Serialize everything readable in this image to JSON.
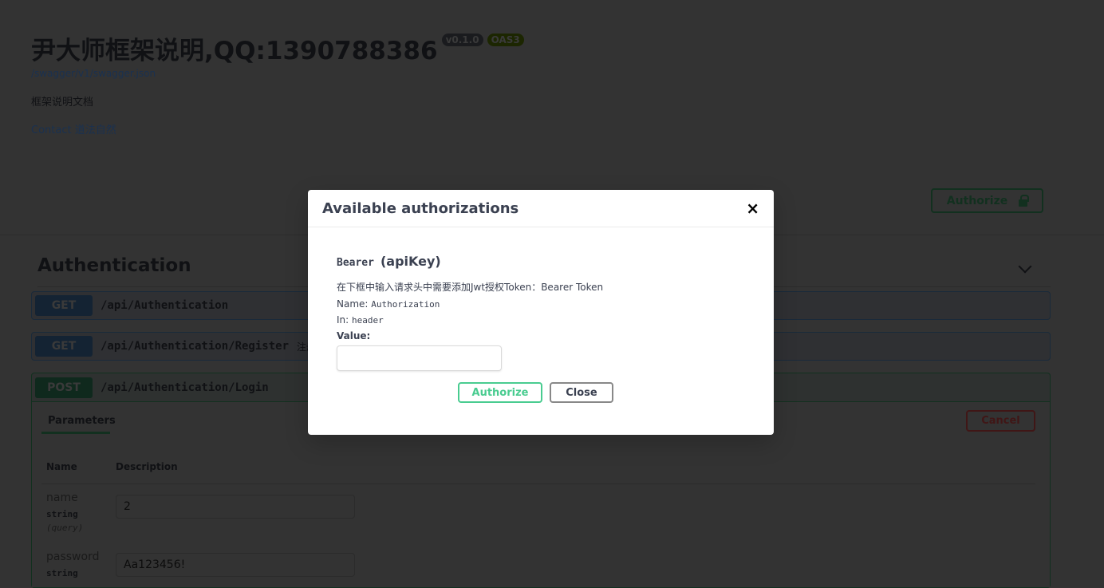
{
  "info": {
    "title": "尹大师框架说明,QQ:1390788386",
    "version": "v0.1.0",
    "oas": "OAS3",
    "spec_url": "/swagger/v1/swagger.json",
    "description": "框架说明文档",
    "contact": "Contact 道法自然"
  },
  "authorize_button": "Authorize",
  "tag": {
    "name": "Authentication"
  },
  "operations": [
    {
      "method": "GET",
      "path": "/api/Authentication",
      "summary": ""
    },
    {
      "method": "GET",
      "path": "/api/Authentication/Register",
      "summary": "注册用户"
    },
    {
      "method": "POST",
      "path": "/api/Authentication/Login",
      "summary": ""
    }
  ],
  "login": {
    "tab": "Parameters",
    "cancel": "Cancel",
    "col_name": "Name",
    "col_desc": "Description",
    "params": [
      {
        "name": "name",
        "type": "string",
        "in": "(query)",
        "value": "2"
      },
      {
        "name": "password",
        "type": "string",
        "in": "(query)",
        "value": "Aa123456!"
      }
    ]
  },
  "modal": {
    "title": "Available authorizations",
    "close_icon": "×",
    "scheme": "Bearer",
    "scheme_type": "(apiKey)",
    "description": "在下框中输入请求头中需要添加Jwt授权Token：Bearer Token",
    "name_label": "Name:",
    "name_value": "Authorization",
    "in_label": "In:",
    "in_value": "header",
    "value_label": "Value:",
    "value": "",
    "authorize": "Authorize",
    "close": "Close"
  },
  "colors": {
    "get": "#61affe",
    "post": "#49cc90",
    "cancel": "#ff6060"
  }
}
